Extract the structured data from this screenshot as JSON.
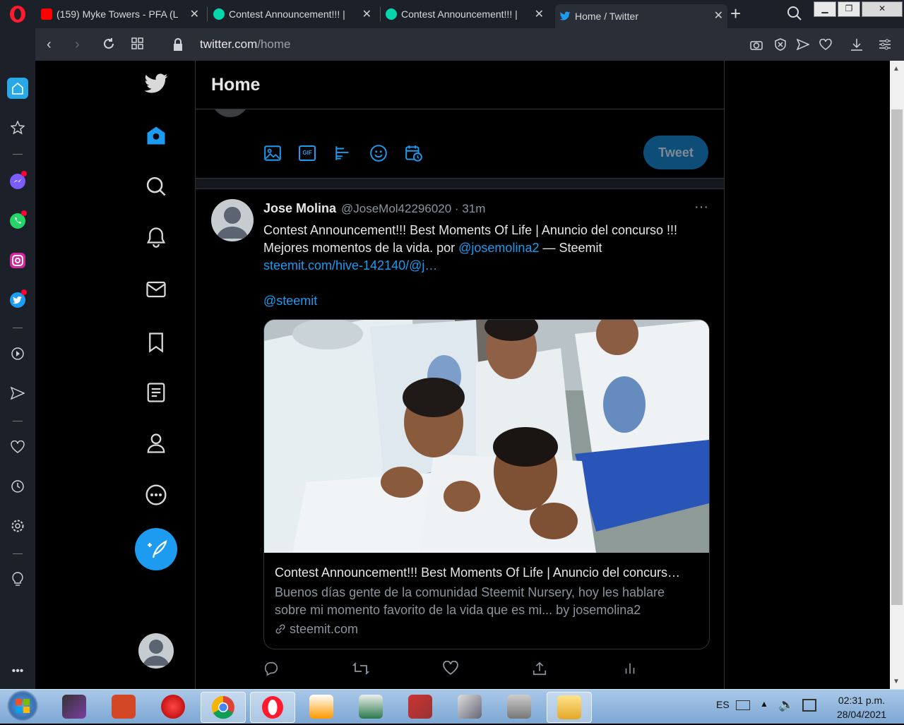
{
  "browser": {
    "tabs": [
      {
        "title": "(159) Myke Towers - PFA (L",
        "color": "#ff0000"
      },
      {
        "title": "Contest Announcement!!! |",
        "color": "#06d6a9"
      },
      {
        "title": "Contest Announcement!!! |",
        "color": "#06d6a9"
      },
      {
        "title": "Home / Twitter",
        "color": "#1d9bf0"
      }
    ],
    "url_domain": "twitter.com",
    "url_path": "/home",
    "new_tab_label": "+"
  },
  "twitter": {
    "header_title": "Home",
    "tweet_button": "Tweet",
    "gif_label": "GIF",
    "tweet": {
      "name": "Jose Molina",
      "handle_time": "@JoseMol42296020 · 31m",
      "text_1": "Contest Announcement!!! Best Moments Of Life | Anuncio del concurso !!! Mejores momentos de la vida. por ",
      "mention_1": "@josemolina2",
      "text_2": " — Steemit",
      "link": "steemit.com/hive-142140/@j…",
      "mention_2": "@steemit",
      "card_title": "Contest Announcement!!! Best Moments Of Life | Anuncio del concurs…",
      "card_description": "Buenos días gente de la comunidad Steemit Nursery, hoy les hablare sobre mi momento favorito de la vida que es mi... by josemolina2",
      "card_domain": "steemit.com",
      "more": "···"
    }
  },
  "taskbar": {
    "language": "ES",
    "time": "02:31 p.m.",
    "date": "28/04/2021"
  },
  "colors": {
    "twitter_blue": "#1d9bf0",
    "opera_red": "#ff1b2d"
  }
}
